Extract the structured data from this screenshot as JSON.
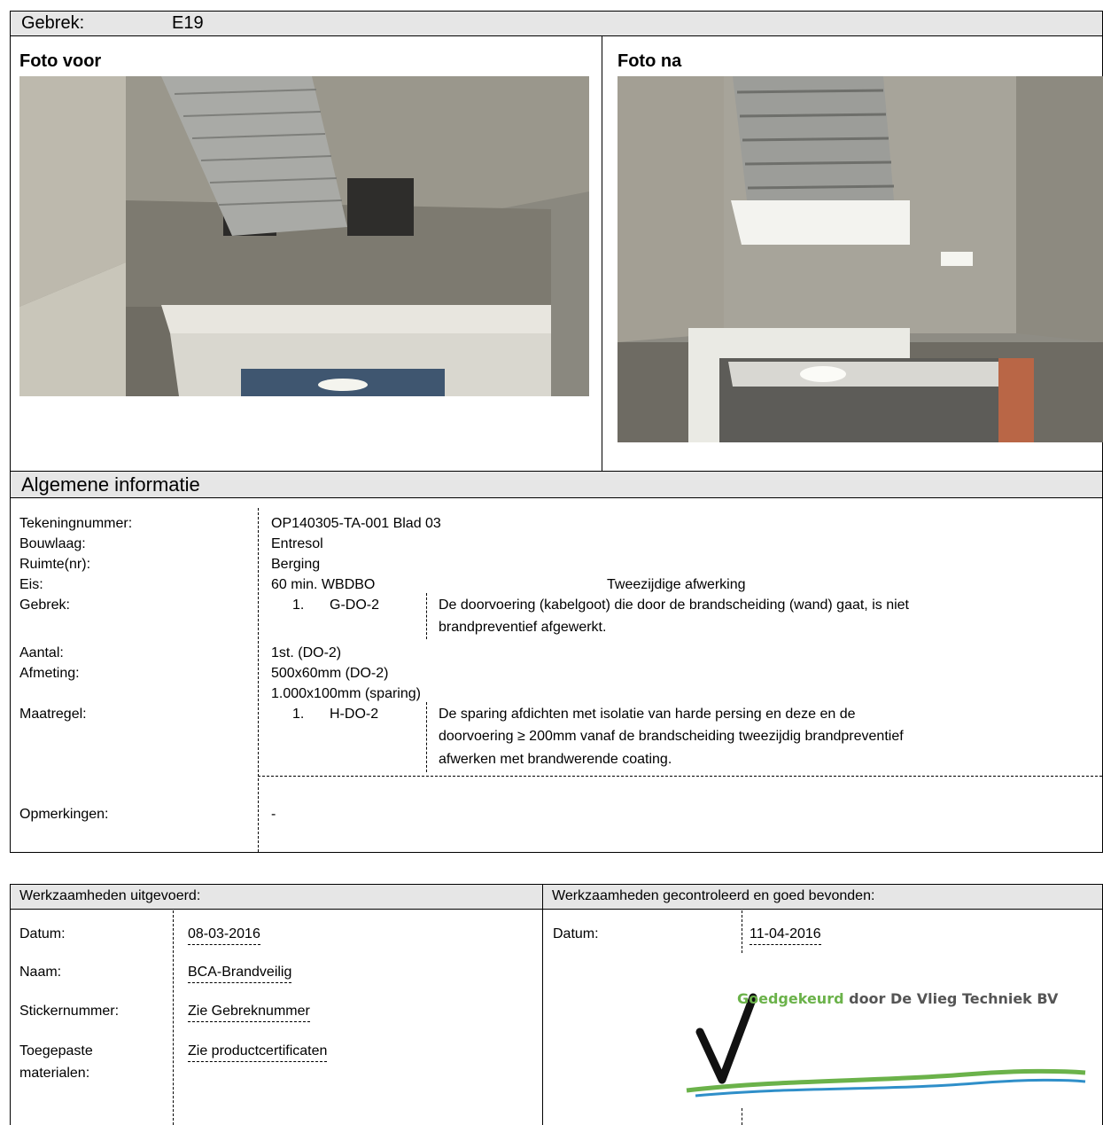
{
  "defect": {
    "label": "Gebrek:",
    "code": "E19"
  },
  "photos": {
    "before_title": "Foto voor",
    "after_title": "Foto na",
    "before_icon": "photo-kabelgoot-voor",
    "after_icon": "photo-kabelgoot-na"
  },
  "general": {
    "heading": "Algemene informatie",
    "tekeningnummer": {
      "label": "Tekeningnummer:",
      "value": "OP140305-TA-001 Blad 03"
    },
    "bouwlaag": {
      "label": "Bouwlaag:",
      "value": "Entresol"
    },
    "ruimte": {
      "label": "Ruimte(nr):",
      "value": "Berging"
    },
    "eis": {
      "label": "Eis:",
      "value": "60 min. WBDBO",
      "extra": "Tweezijdige afwerking"
    },
    "gebrek": {
      "label": "Gebrek:",
      "num": "1.",
      "code": "G-DO-2",
      "line1": "De doorvoering (kabelgoot) die door de brandscheiding (wand) gaat, is niet",
      "line2": "brandpreventief afgewerkt."
    },
    "aantal": {
      "label": "Aantal:",
      "value": "1st. (DO-2)"
    },
    "afmeting": {
      "label": "Afmeting:",
      "value1": "500x60mm (DO-2)",
      "value2": "1.000x100mm (sparing)"
    },
    "maatregel": {
      "label": "Maatregel:",
      "num": "1.",
      "code": "H-DO-2",
      "line1": "De sparing afdichten met isolatie van harde persing en deze en de",
      "line2": "doorvoering ≥ 200mm vanaf de brandscheiding tweezijdig brandpreventief",
      "line3": "afwerken met brandwerende coating."
    },
    "opmerkingen": {
      "label": "Opmerkingen:",
      "value": "-"
    }
  },
  "work": {
    "executed_heading": "Werkzaamheden uitgevoerd:",
    "checked_heading": "Werkzaamheden gecontroleerd en goed bevonden:",
    "datum_label": "Datum:",
    "datum_value": "08-03-2016",
    "naam_label": "Naam:",
    "naam_value": "BCA-Brandveilig",
    "sticker_label": "Stickernummer:",
    "sticker_value": "Zie Gebreknummer",
    "mat_label1": "Toegepaste",
    "mat_label2": "materialen:",
    "mat_value": "Zie productcertificaten",
    "check_datum_label": "Datum:",
    "check_datum_value": "11-04-2016"
  },
  "stamp": {
    "word1": "Goedgekeurd",
    "word2": "door De Vlieg Techniek BV",
    "green": "#6bb24a",
    "blue": "#2f8fc9"
  }
}
